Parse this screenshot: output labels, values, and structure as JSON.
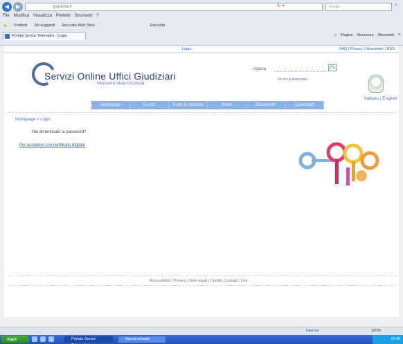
{
  "browser": {
    "address": "giustizia.it",
    "search_engine": "Google",
    "menu": [
      "File",
      "Modifica",
      "Visualizza",
      "Preferiti",
      "Strumenti",
      "?"
    ],
    "favorites": [
      "Preferiti",
      "Siti suggeriti",
      "Raccolta Web Slice"
    ],
    "favorites_extra": "Raccolta",
    "tab_title": "Portale Servizi Telematici - Login",
    "commands": [
      "Pagina",
      "Sicurezza",
      "Strumenti"
    ],
    "status_zone": "Internet",
    "zoom": "100%"
  },
  "page": {
    "login_top": "Login",
    "util_links": "FAQ | Privacy | Newsletter | RSS",
    "brand_title": "Servizi Online Uffici Giudiziari",
    "brand_sub": "Ministero della Giustizia",
    "search_label": "ricerca",
    "search_button": "Go",
    "adv_search": "Ricerca Avanzata",
    "language": "Italiano | English",
    "nav": [
      "Homepage",
      "Servizi",
      "Punti di Accesso",
      "News",
      "Documenti",
      "Download"
    ],
    "breadcrumb": "Homepage > Login",
    "forgot_password": "Hai dimenticato la password?",
    "pcr_link": "Per accedere con certificato digitale",
    "footer": "Accessibilità | Privacy | Note legali | Crediti | Contatti | Link"
  },
  "taskbar": {
    "start": "start",
    "tasks": [
      "Portale Servizi Telematici",
      "Nuova scheda"
    ],
    "clock": "10:45"
  },
  "colors": {
    "accent": "#8bb2e3",
    "brand": "#2c3f66",
    "link": "#2b5aa8"
  }
}
